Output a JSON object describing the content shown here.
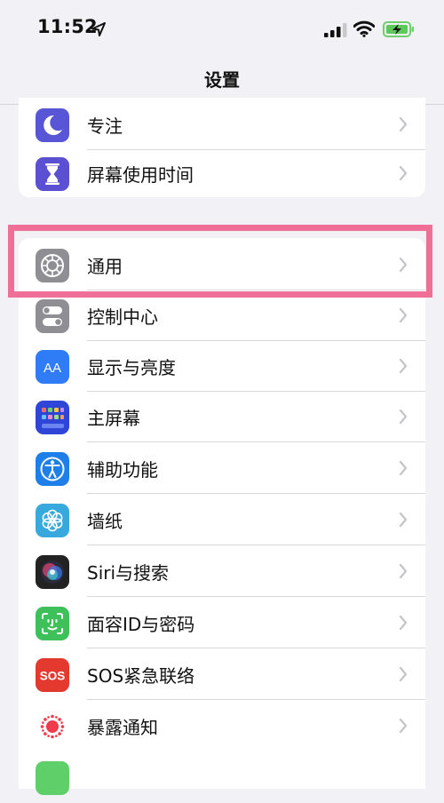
{
  "status_bar": {
    "time": "11:52"
  },
  "nav": {
    "title": "设置"
  },
  "groups": [
    {
      "items": [
        {
          "label": "专注",
          "icon": "moon-icon",
          "color": "#5856d6"
        },
        {
          "label": "屏幕使用时间",
          "icon": "hourglass-icon",
          "color": "#5b4fd2"
        }
      ]
    },
    {
      "items": [
        {
          "label": "通用",
          "icon": "gear-icon",
          "color": "#8e8e93",
          "highlighted": true
        },
        {
          "label": "控制中心",
          "icon": "toggles-icon",
          "color": "#8e8e93"
        },
        {
          "label": "显示与亮度",
          "icon": "text-size-icon",
          "color": "#2f7cf6"
        },
        {
          "label": "主屏幕",
          "icon": "home-grid-icon",
          "color": "#2f45d8"
        },
        {
          "label": "辅助功能",
          "icon": "accessibility-icon",
          "color": "#1f7fe8"
        },
        {
          "label": "墙纸",
          "icon": "flower-icon",
          "color": "#38a9dc"
        },
        {
          "label": "Siri与搜索",
          "icon": "siri-icon",
          "color": "#222222"
        },
        {
          "label": "面容ID与密码",
          "icon": "face-id-icon",
          "color": "#3ec15a"
        },
        {
          "label": "SOS紧急联络",
          "icon": "sos-icon",
          "color": "#e3392f"
        },
        {
          "label": "暴露通知",
          "icon": "exposure-icon",
          "color": "#ffffff"
        }
      ]
    }
  ],
  "highlight_color": "#ef6f96"
}
